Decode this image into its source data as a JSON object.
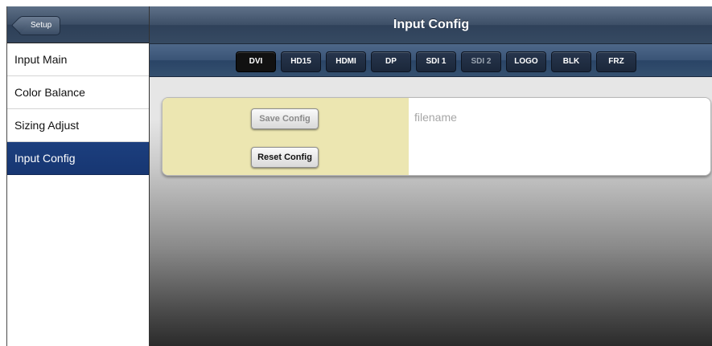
{
  "sidebar": {
    "back_label": "Setup",
    "items": [
      {
        "label": "Input Main",
        "active": false
      },
      {
        "label": "Color Balance",
        "active": false
      },
      {
        "label": "Sizing Adjust",
        "active": false
      },
      {
        "label": "Input Config",
        "active": true
      }
    ]
  },
  "main": {
    "title": "Input Config",
    "inputs": [
      {
        "label": "DVI",
        "state": "selected"
      },
      {
        "label": "HD15",
        "state": "normal"
      },
      {
        "label": "HDMI",
        "state": "normal"
      },
      {
        "label": "DP",
        "state": "normal"
      },
      {
        "label": "SDI 1",
        "state": "normal"
      },
      {
        "label": "SDI 2",
        "state": "disabled"
      },
      {
        "label": "LOGO",
        "state": "normal"
      },
      {
        "label": "BLK",
        "state": "normal"
      },
      {
        "label": "FRZ",
        "state": "normal"
      }
    ],
    "config": {
      "save_label": "Save Config",
      "save_enabled": false,
      "filename_placeholder": "filename",
      "filename_value": "",
      "reset_label": "Reset Config"
    }
  },
  "colors": {
    "header_blue": "#3d4f67",
    "active_nav": "#1c3f7e",
    "label_cell": "#ece6b1"
  }
}
